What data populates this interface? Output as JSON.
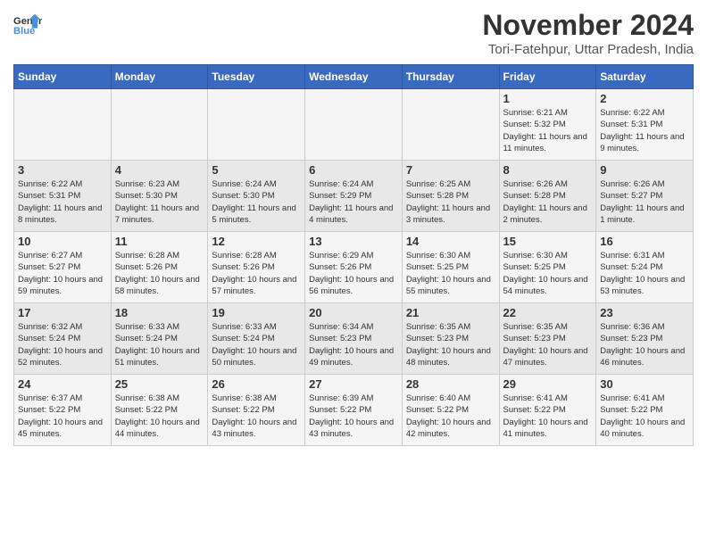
{
  "logo": {
    "line1": "General",
    "line2": "Blue"
  },
  "title": "November 2024",
  "subtitle": "Tori-Fatehpur, Uttar Pradesh, India",
  "days_of_week": [
    "Sunday",
    "Monday",
    "Tuesday",
    "Wednesday",
    "Thursday",
    "Friday",
    "Saturday"
  ],
  "weeks": [
    [
      {
        "num": "",
        "info": ""
      },
      {
        "num": "",
        "info": ""
      },
      {
        "num": "",
        "info": ""
      },
      {
        "num": "",
        "info": ""
      },
      {
        "num": "",
        "info": ""
      },
      {
        "num": "1",
        "info": "Sunrise: 6:21 AM\nSunset: 5:32 PM\nDaylight: 11 hours and 11 minutes."
      },
      {
        "num": "2",
        "info": "Sunrise: 6:22 AM\nSunset: 5:31 PM\nDaylight: 11 hours and 9 minutes."
      }
    ],
    [
      {
        "num": "3",
        "info": "Sunrise: 6:22 AM\nSunset: 5:31 PM\nDaylight: 11 hours and 8 minutes."
      },
      {
        "num": "4",
        "info": "Sunrise: 6:23 AM\nSunset: 5:30 PM\nDaylight: 11 hours and 7 minutes."
      },
      {
        "num": "5",
        "info": "Sunrise: 6:24 AM\nSunset: 5:30 PM\nDaylight: 11 hours and 5 minutes."
      },
      {
        "num": "6",
        "info": "Sunrise: 6:24 AM\nSunset: 5:29 PM\nDaylight: 11 hours and 4 minutes."
      },
      {
        "num": "7",
        "info": "Sunrise: 6:25 AM\nSunset: 5:28 PM\nDaylight: 11 hours and 3 minutes."
      },
      {
        "num": "8",
        "info": "Sunrise: 6:26 AM\nSunset: 5:28 PM\nDaylight: 11 hours and 2 minutes."
      },
      {
        "num": "9",
        "info": "Sunrise: 6:26 AM\nSunset: 5:27 PM\nDaylight: 11 hours and 1 minute."
      }
    ],
    [
      {
        "num": "10",
        "info": "Sunrise: 6:27 AM\nSunset: 5:27 PM\nDaylight: 10 hours and 59 minutes."
      },
      {
        "num": "11",
        "info": "Sunrise: 6:28 AM\nSunset: 5:26 PM\nDaylight: 10 hours and 58 minutes."
      },
      {
        "num": "12",
        "info": "Sunrise: 6:28 AM\nSunset: 5:26 PM\nDaylight: 10 hours and 57 minutes."
      },
      {
        "num": "13",
        "info": "Sunrise: 6:29 AM\nSunset: 5:26 PM\nDaylight: 10 hours and 56 minutes."
      },
      {
        "num": "14",
        "info": "Sunrise: 6:30 AM\nSunset: 5:25 PM\nDaylight: 10 hours and 55 minutes."
      },
      {
        "num": "15",
        "info": "Sunrise: 6:30 AM\nSunset: 5:25 PM\nDaylight: 10 hours and 54 minutes."
      },
      {
        "num": "16",
        "info": "Sunrise: 6:31 AM\nSunset: 5:24 PM\nDaylight: 10 hours and 53 minutes."
      }
    ],
    [
      {
        "num": "17",
        "info": "Sunrise: 6:32 AM\nSunset: 5:24 PM\nDaylight: 10 hours and 52 minutes."
      },
      {
        "num": "18",
        "info": "Sunrise: 6:33 AM\nSunset: 5:24 PM\nDaylight: 10 hours and 51 minutes."
      },
      {
        "num": "19",
        "info": "Sunrise: 6:33 AM\nSunset: 5:24 PM\nDaylight: 10 hours and 50 minutes."
      },
      {
        "num": "20",
        "info": "Sunrise: 6:34 AM\nSunset: 5:23 PM\nDaylight: 10 hours and 49 minutes."
      },
      {
        "num": "21",
        "info": "Sunrise: 6:35 AM\nSunset: 5:23 PM\nDaylight: 10 hours and 48 minutes."
      },
      {
        "num": "22",
        "info": "Sunrise: 6:35 AM\nSunset: 5:23 PM\nDaylight: 10 hours and 47 minutes."
      },
      {
        "num": "23",
        "info": "Sunrise: 6:36 AM\nSunset: 5:23 PM\nDaylight: 10 hours and 46 minutes."
      }
    ],
    [
      {
        "num": "24",
        "info": "Sunrise: 6:37 AM\nSunset: 5:22 PM\nDaylight: 10 hours and 45 minutes."
      },
      {
        "num": "25",
        "info": "Sunrise: 6:38 AM\nSunset: 5:22 PM\nDaylight: 10 hours and 44 minutes."
      },
      {
        "num": "26",
        "info": "Sunrise: 6:38 AM\nSunset: 5:22 PM\nDaylight: 10 hours and 43 minutes."
      },
      {
        "num": "27",
        "info": "Sunrise: 6:39 AM\nSunset: 5:22 PM\nDaylight: 10 hours and 43 minutes."
      },
      {
        "num": "28",
        "info": "Sunrise: 6:40 AM\nSunset: 5:22 PM\nDaylight: 10 hours and 42 minutes."
      },
      {
        "num": "29",
        "info": "Sunrise: 6:41 AM\nSunset: 5:22 PM\nDaylight: 10 hours and 41 minutes."
      },
      {
        "num": "30",
        "info": "Sunrise: 6:41 AM\nSunset: 5:22 PM\nDaylight: 10 hours and 40 minutes."
      }
    ]
  ]
}
